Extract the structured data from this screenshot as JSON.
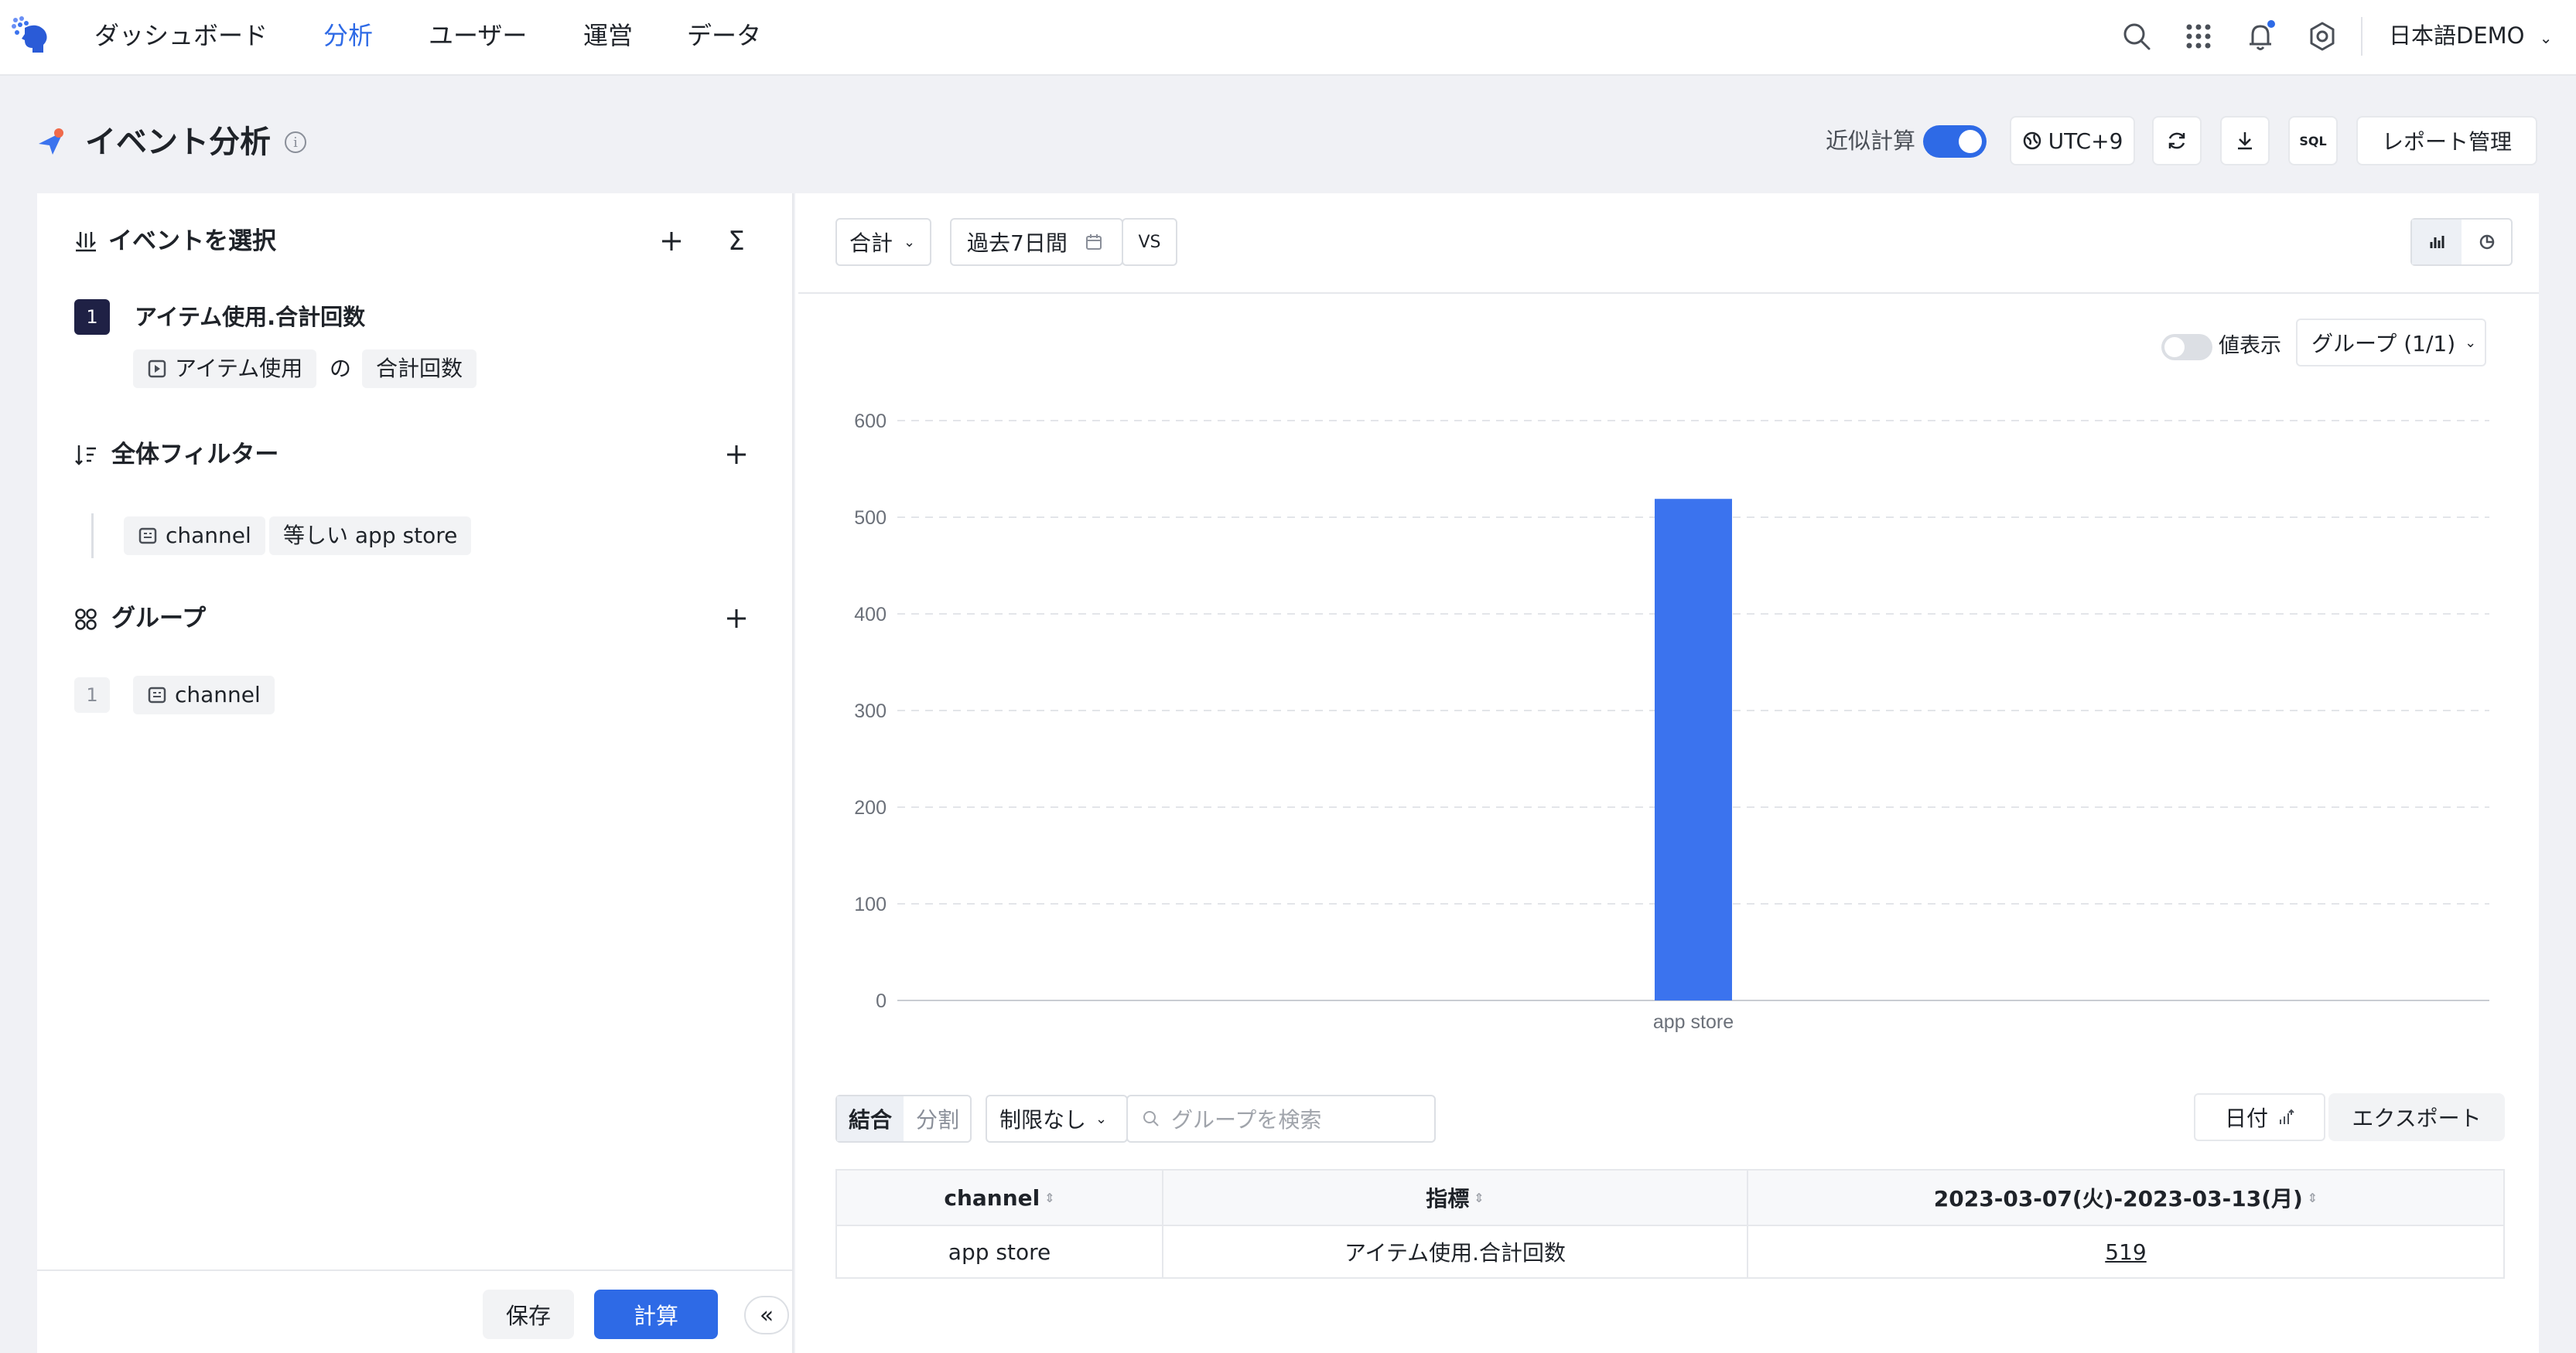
{
  "nav": {
    "items": [
      "ダッシュボード",
      "分析",
      "ユーザー",
      "運営",
      "データ"
    ],
    "active_index": 1,
    "project": "日本語DEMO",
    "icons": [
      "logo-icon",
      "search-icon",
      "apps-grid-icon",
      "bell-icon",
      "settings-icon",
      "chevron-down-icon"
    ]
  },
  "header": {
    "title": "イベント分析",
    "approx_label": "近似計算",
    "approx_on": true,
    "timezone": "UTC+9",
    "sql_label": "SQL",
    "report_button": "レポート管理"
  },
  "left": {
    "events": {
      "title": "イベントを選択",
      "item_index": "1",
      "item_title": "アイテム使用.合計回数",
      "event_tag": "アイテム使用",
      "connector": "の",
      "metric_tag": "合計回数"
    },
    "filter": {
      "title": "全体フィルター",
      "property": "channel",
      "condition": "等しい app store"
    },
    "group": {
      "title": "グループ",
      "index": "1",
      "property": "channel"
    },
    "save_button": "保存",
    "calc_button": "計算",
    "collapse_label": "«"
  },
  "toolbar": {
    "aggregate": "合計",
    "date_range": "過去7日間",
    "vs_label": "VS"
  },
  "chart_controls": {
    "value_display_label": "値表示",
    "value_display_on": false,
    "group_select": "グループ (1/1)"
  },
  "chart_data": {
    "type": "bar",
    "categories": [
      "app store"
    ],
    "series": [
      {
        "values": [
          519
        ]
      }
    ],
    "ylim": [
      0,
      600
    ],
    "yticks": [
      "0",
      "100",
      "200",
      "300",
      "400",
      "500",
      "600"
    ],
    "grid": true,
    "bar_color": "#3b73ee"
  },
  "table_controls": {
    "merge": "結合",
    "split": "分割",
    "limit": "制限なし",
    "search_placeholder": "グループを検索",
    "date_button": "日付",
    "export_button": "エクスポート"
  },
  "table": {
    "headers": [
      "channel",
      "指標",
      "2023-03-07(火)-2023-03-13(月)"
    ],
    "rows": [
      [
        "app store",
        "アイテム使用.合計回数",
        "519"
      ]
    ]
  },
  "colors": {
    "accent": "#2e6ae6",
    "bar": "#3b73ee",
    "dark_badge": "#1f2145"
  }
}
